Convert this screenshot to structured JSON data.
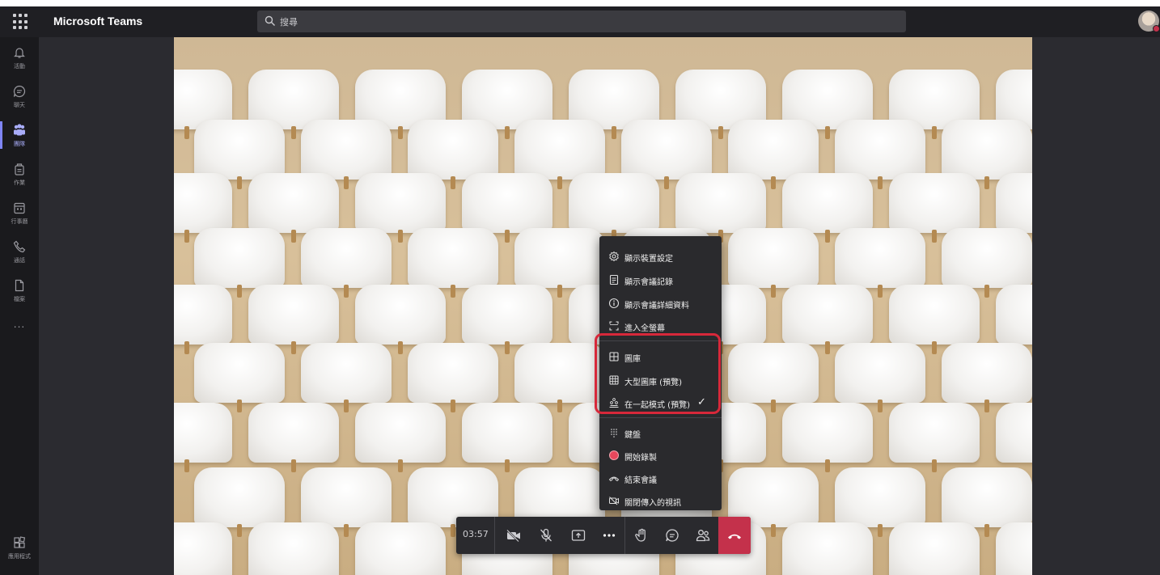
{
  "app": {
    "title": "Microsoft Teams"
  },
  "search": {
    "placeholder": "搜尋"
  },
  "rail": {
    "items": [
      {
        "label": "活動",
        "icon": "bell-icon"
      },
      {
        "label": "聊天",
        "icon": "chat-icon"
      },
      {
        "label": "團隊",
        "icon": "teams-icon",
        "active": true
      },
      {
        "label": "作業",
        "icon": "assignments-icon"
      },
      {
        "label": "行事曆",
        "icon": "calendar-icon"
      },
      {
        "label": "通話",
        "icon": "phone-icon"
      },
      {
        "label": "檔案",
        "icon": "file-icon"
      }
    ],
    "more": "...",
    "apps_label": "應用程式"
  },
  "menu": {
    "items": [
      {
        "label": "顯示裝置設定",
        "icon": "gear-icon"
      },
      {
        "label": "顯示會議記錄",
        "icon": "notes-icon"
      },
      {
        "label": "顯示會議詳細資料",
        "icon": "info-icon"
      },
      {
        "label": "進入全螢幕",
        "icon": "fullscreen-icon"
      },
      {
        "label": "圖庫",
        "icon": "grid-icon"
      },
      {
        "label": "大型圖庫 (預覽)",
        "icon": "large-grid-icon"
      },
      {
        "label": "在一起模式 (預覽)",
        "icon": "together-mode-icon",
        "checked": true
      },
      {
        "label": "鍵盤",
        "icon": "keypad-icon"
      },
      {
        "label": "開始錄製",
        "icon": "record-icon"
      },
      {
        "label": "結束會議",
        "icon": "end-call-icon"
      },
      {
        "label": "關閉傳入的視訊",
        "icon": "video-off-icon"
      }
    ],
    "check_mark": "✓"
  },
  "controls": {
    "timer": "03:57",
    "buttons": [
      "camera-off-icon",
      "mic-off-icon",
      "share-screen-icon",
      "more-options-icon",
      "raise-hand-icon",
      "chat-icon",
      "participants-icon",
      "hang-up-icon"
    ]
  },
  "colors": {
    "accent": "#7f85f5",
    "hangup": "#c4314b",
    "highlight": "#d7283a",
    "record": "#e8475c"
  }
}
